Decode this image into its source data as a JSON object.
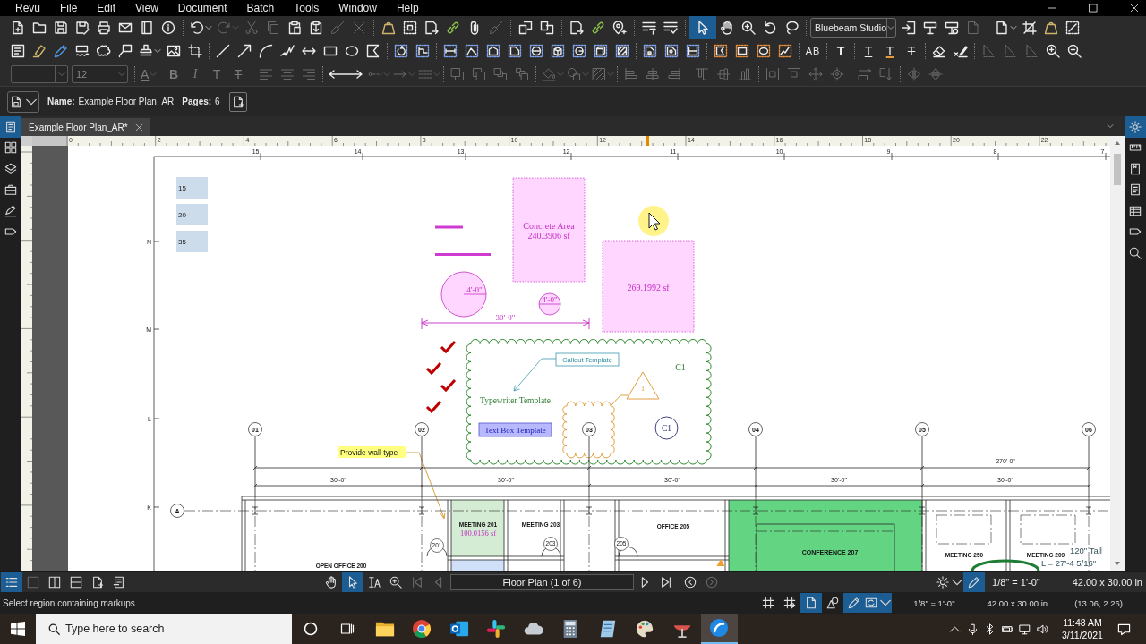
{
  "menu": [
    "Revu",
    "File",
    "Edit",
    "View",
    "Document",
    "Batch",
    "Tools",
    "Window",
    "Help"
  ],
  "toolbars": [
    {
      "buttons": [
        {
          "disabled": false
        },
        {
          "disabled": false
        },
        {
          "disabled": false
        },
        {
          "disabled": false
        },
        {
          "disabled": false
        },
        {
          "disabled": false
        },
        {
          "disabled": false
        },
        {
          "disabled": false
        },
        {
          "disabled": false
        },
        {
          "disabled": true
        },
        {
          "disabled": true
        },
        {
          "disabled": true
        },
        {
          "disabled": false
        },
        {
          "disabled": false
        },
        {
          "disabled": true
        },
        {
          "disabled": true
        },
        {
          "disabled": false
        },
        {
          "disabled": false
        },
        {
          "disabled": false
        },
        {
          "disabled": false
        },
        {
          "disabled": false
        },
        {
          "disabled": true
        },
        {
          "disabled": false
        },
        {
          "disabled": false
        },
        {
          "disabled": false
        },
        {
          "disabled": false
        },
        {
          "disabled": false
        },
        {
          "disabled": false
        },
        {
          "disabled": false
        },
        {
          "disabled": false
        },
        {
          "disabled": false
        },
        {
          "disabled": false
        },
        {
          "disabled": true
        },
        {
          "disabled": false
        },
        {
          "disabled": false
        },
        {
          "disabled": false
        },
        {
          "disabled": false
        }
      ]
    },
    {
      "buttons": [
        {
          "disabled": false
        },
        {
          "disabled": false
        },
        {
          "disabled": false
        },
        {
          "disabled": false
        },
        {
          "disabled": false
        },
        {
          "disabled": false
        },
        {
          "disabled": false
        },
        {
          "disabled": false
        },
        {
          "disabled": false
        },
        {
          "disabled": false
        },
        {
          "disabled": false
        },
        {
          "disabled": false
        },
        {
          "disabled": false
        },
        {
          "disabled": false
        },
        {
          "disabled": false
        },
        {
          "disabled": false
        },
        {
          "disabled": false
        },
        {
          "disabled": false
        },
        {
          "disabled": false
        },
        {
          "disabled": false
        },
        {
          "disabled": false
        },
        {
          "disabled": false
        },
        {
          "disabled": false
        },
        {
          "disabled": false
        },
        {
          "disabled": false
        },
        {
          "disabled": false
        },
        {
          "disabled": false
        },
        {
          "disabled": false
        },
        {
          "disabled": false
        },
        {
          "disabled": false
        },
        {
          "disabled": false
        },
        {
          "disabled": false
        },
        {
          "disabled": false
        },
        {
          "disabled": false
        },
        {
          "disabled": false
        },
        {
          "glyph": "AB",
          "disabled": false
        },
        {
          "glyph": "T",
          "disabled": false
        },
        {
          "glyph": "T",
          "disabled": false
        },
        {
          "glyph": "T",
          "disabled": false
        },
        {
          "glyph": "T",
          "disabled": false
        },
        {
          "disabled": false
        },
        {
          "disabled": false
        },
        {
          "disabled": true
        },
        {
          "disabled": true
        },
        {
          "disabled": true
        },
        {
          "disabled": false
        },
        {
          "disabled": false
        }
      ]
    },
    {
      "buttons": [
        {
          "glyph": "A",
          "disabled": true
        },
        {
          "glyph": "B",
          "disabled": true
        },
        {
          "glyph": "I",
          "disabled": true
        },
        {
          "glyph": "T",
          "disabled": true
        },
        {
          "glyph": "T",
          "disabled": true
        },
        {
          "disabled": true
        },
        {
          "disabled": true
        },
        {
          "disabled": true
        },
        {
          "disabled": false
        },
        {
          "disabled": true
        },
        {
          "disabled": true
        },
        {
          "disabled": true
        },
        {
          "disabled": true
        },
        {
          "disabled": true
        },
        {
          "disabled": true
        },
        {
          "disabled": true
        },
        {
          "disabled": true
        },
        {
          "disabled": true
        },
        {
          "disabled": true
        },
        {
          "disabled": true
        },
        {
          "disabled": true
        },
        {
          "disabled": true
        },
        {
          "disabled": true
        },
        {
          "disabled": true
        },
        {
          "disabled": true
        },
        {
          "disabled": true
        },
        {
          "disabled": true
        },
        {
          "disabled": true
        },
        {
          "disabled": true
        },
        {
          "disabled": true
        },
        {
          "disabled": true
        },
        {
          "disabled": true
        },
        {
          "disabled": true
        }
      ]
    }
  ],
  "tool_modes": [
    {
      "selected": true
    },
    {
      "selected": false
    },
    {
      "selected": false
    },
    {
      "selected": false
    },
    {
      "selected": false
    }
  ],
  "studio_menu": {
    "value": "Bluebeam Studio"
  },
  "font_family": {
    "disabled": true
  },
  "font_size": {
    "value": "12",
    "disabled": true
  },
  "document_bar": {
    "name_label": "Name:",
    "name": "Example Floor Plan_AR",
    "pages_label": "Pages:",
    "pages": "6"
  },
  "left_panel_tabs": [
    {
      "selected": true
    },
    {
      "selected": false
    },
    {
      "selected": false
    },
    {
      "selected": false
    },
    {
      "selected": false
    },
    {
      "selected": false
    }
  ],
  "document_tabs": [
    {
      "title": "Example Floor Plan_AR*",
      "selected": true
    }
  ],
  "right_panel_tabs": [
    {
      "selected": true
    },
    {
      "selected": false
    },
    {
      "selected": false
    },
    {
      "selected": false
    },
    {
      "selected": false
    },
    {
      "selected": false
    },
    {
      "selected": false
    }
  ],
  "rulers": {
    "top_labels": [
      "0",
      "2",
      "4",
      "6",
      "8",
      "10",
      "12",
      "14",
      "16",
      "18",
      "20",
      "22"
    ]
  },
  "drawing": {
    "column_labels": [
      "15",
      "14",
      "13",
      "12",
      "11",
      "10",
      "9",
      "8",
      "7"
    ],
    "row_labels": [
      "N",
      "M",
      "L",
      "K"
    ],
    "quantity_labels": [
      "15",
      "20",
      "35"
    ],
    "markups": [
      {
        "kind": "area",
        "lines": [
          "Concrete Area",
          "240.3906 sf"
        ]
      },
      {
        "kind": "area",
        "lines": [
          "269.1992 sf"
        ]
      },
      {
        "kind": "circle",
        "label": "4'-0\""
      },
      {
        "kind": "circle",
        "label": "4'-0\""
      },
      {
        "kind": "dimension",
        "label": "30'-0\""
      },
      {
        "kind": "callout",
        "label": "Callout Template"
      },
      {
        "kind": "typewriter",
        "label": "Typewriter Template"
      },
      {
        "kind": "text_box",
        "label": "Text Box Template"
      },
      {
        "kind": "label",
        "label": "C1"
      },
      {
        "kind": "triangle",
        "label": "1"
      },
      {
        "kind": "bubble",
        "label": "C1"
      },
      {
        "kind": "note",
        "label": "Provide wall type"
      }
    ]
  },
  "floor_plan": {
    "grid_bubbles": [
      "01",
      "02",
      "03",
      "04",
      "05",
      "06"
    ],
    "row_bubble": "A",
    "overall_dimension": "270'-0\"",
    "bay_dimensions": [
      "30'-0\"",
      "30'-0\"",
      "30'-0\"",
      "30'-0\"",
      "30'-0\""
    ],
    "rooms": [
      {
        "name": "MEETING 201",
        "area": "100.0156 sf"
      },
      {
        "name": "MEETING 203"
      },
      {
        "name": "OFFICE 205"
      },
      {
        "name": "CONFERENCE 207"
      },
      {
        "name": "MEETING 250"
      },
      {
        "name": "MEETING 209"
      },
      {
        "name": "OPEN OFFICE 200"
      }
    ],
    "door_tags": [
      "201",
      "203",
      "205"
    ],
    "measurement_notes": [
      "120\" Tall",
      "L = 27'-4 5/16\""
    ]
  },
  "bottom_bar": {
    "view_buttons": [
      {
        "on": true,
        "disabled": false
      },
      {
        "on": false,
        "disabled": true
      },
      {
        "on": false,
        "disabled": false
      },
      {
        "on": false,
        "disabled": false
      },
      {
        "on": false,
        "disabled": false
      },
      {
        "on": false,
        "disabled": false
      }
    ],
    "tools": [
      {
        "selected": false
      },
      {
        "selected": true
      },
      {
        "selected": false
      },
      {
        "selected": false
      }
    ],
    "nav_buttons": [
      {
        "disabled": true
      },
      {
        "disabled": true
      },
      {
        "disabled": false
      },
      {
        "disabled": false
      },
      {
        "disabled": false
      },
      {
        "disabled": true
      }
    ],
    "page": "Floor Plan (1 of 6)",
    "toggles": [
      {
        "on": false
      },
      {
        "on": true
      }
    ],
    "scale": "1/8\" = 1'-0\"",
    "size": "42.00 x 30.00 in"
  },
  "status_bar": {
    "message": "Select region containing markups",
    "toggles": [
      {
        "on": false
      },
      {
        "on": false
      },
      {
        "on": true
      },
      {
        "on": false
      },
      {
        "on": true
      },
      {
        "on": true
      }
    ],
    "scale": "1/8\" = 1'-0\"",
    "size": "42.00 x 30.00 in",
    "coordinates": "(13.06, 2.26)"
  },
  "taskbar": {
    "search": {
      "placeholder": "Type here to search"
    },
    "apps": [
      {
        "selected": false
      },
      {
        "selected": false
      },
      {
        "selected": false
      },
      {
        "selected": false
      },
      {
        "selected": false
      },
      {
        "selected": false
      },
      {
        "selected": false
      },
      {
        "selected": false
      },
      {
        "selected": false
      },
      {
        "selected": true
      }
    ],
    "time": "11:48 AM",
    "date": "3/11/2021"
  }
}
